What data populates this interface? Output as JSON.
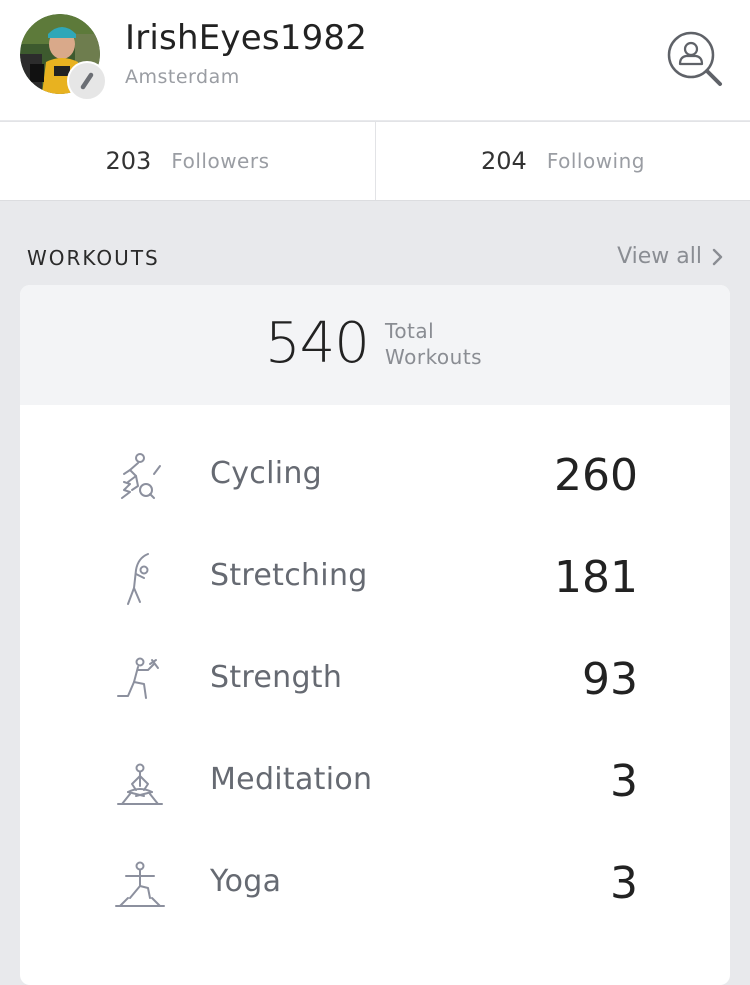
{
  "profile": {
    "username": "IrishEyes1982",
    "location": "Amsterdam"
  },
  "follow": {
    "followers_count": "203",
    "followers_label": "Followers",
    "following_count": "204",
    "following_label": "Following"
  },
  "workouts": {
    "section_title": "WORKOUTS",
    "view_all": "View all",
    "total_count": "540",
    "total_label": "Total Workouts",
    "items": [
      {
        "name": "Cycling",
        "count": "260",
        "icon": "cycling-icon"
      },
      {
        "name": "Stretching",
        "count": "181",
        "icon": "stretching-icon"
      },
      {
        "name": "Strength",
        "count": "93",
        "icon": "strength-icon"
      },
      {
        "name": "Meditation",
        "count": "3",
        "icon": "meditation-icon"
      },
      {
        "name": "Yoga",
        "count": "3",
        "icon": "yoga-icon"
      }
    ]
  },
  "colors": {
    "background": "#e8e9ec",
    "icon_stroke": "#8c909e",
    "muted_text": "#9a9da3"
  }
}
